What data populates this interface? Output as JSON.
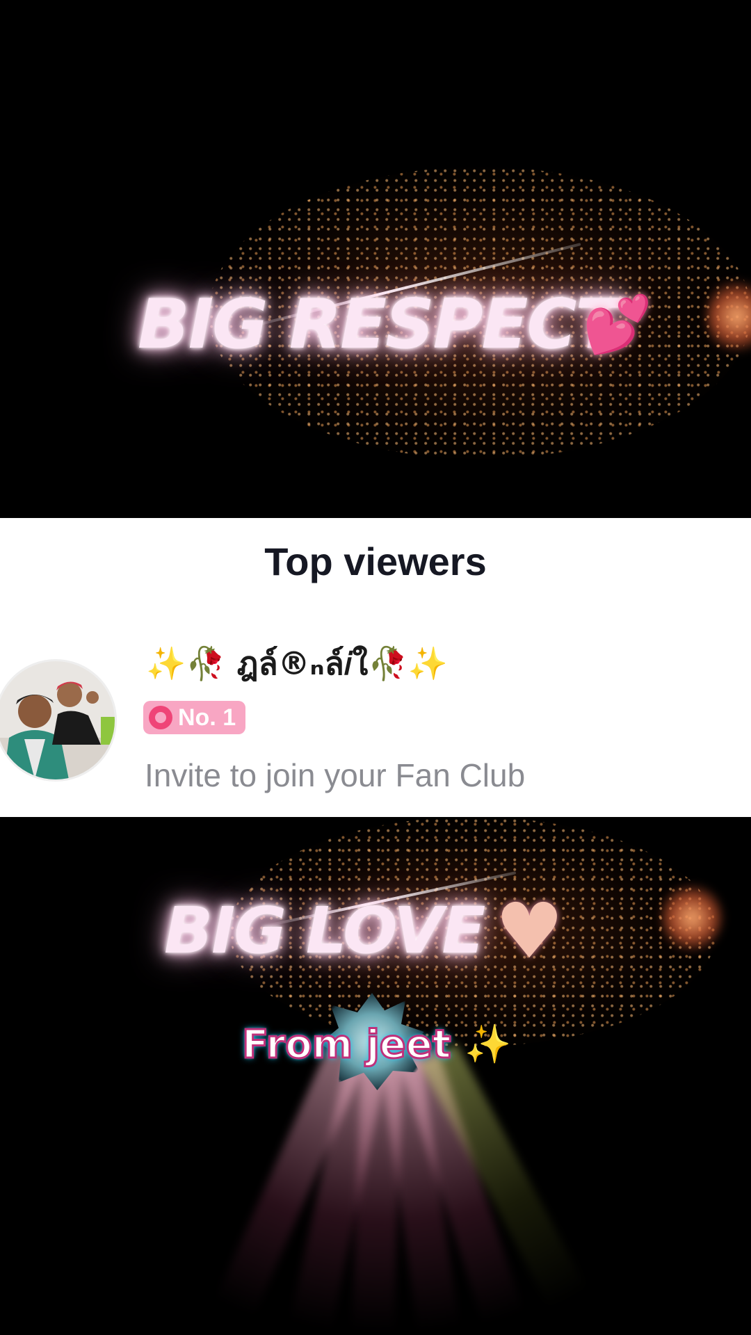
{
  "effect_top": {
    "text": "BIG RESPECT",
    "emoji": "💕"
  },
  "panel": {
    "title": "Top viewers",
    "viewer": {
      "username": "✨🥀 ฎล์®ₙล์𝑖ใ🥀✨",
      "rank_label": "No. 1",
      "action_text": "Invite to join your Fan Club"
    }
  },
  "effect_bottom": {
    "text": "BIG LOVE",
    "emoji": "♥",
    "from_label": "From jeet",
    "sparkle_emoji": "✨"
  },
  "colors": {
    "glow_text": "#fbe6f4",
    "rank_badge": "#f8a6c3",
    "rank_icon": "#ef4477",
    "invite_text": "#8a8b91",
    "title_text": "#161823",
    "label_stroke": "#c0307a",
    "label_glow": "#28e0ff"
  }
}
